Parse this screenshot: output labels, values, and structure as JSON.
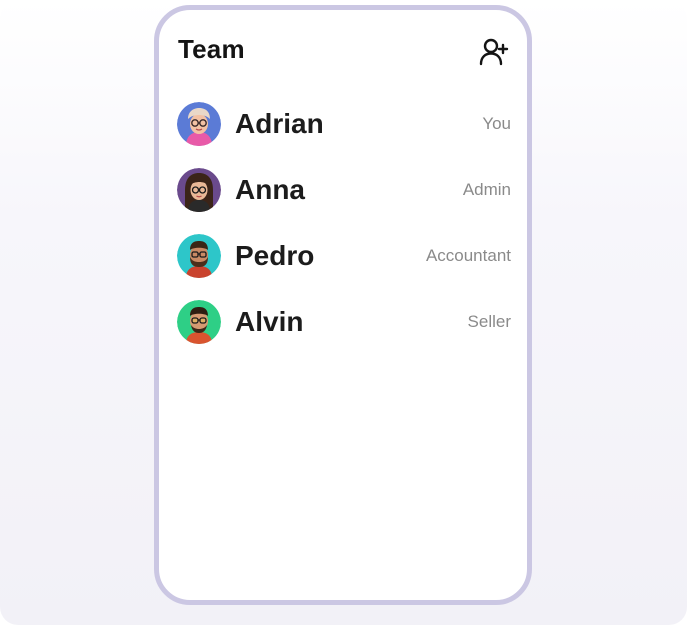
{
  "header": {
    "title": "Team",
    "add_icon": "user-plus-icon"
  },
  "members": [
    {
      "name": "Adrian",
      "role": "You",
      "avatar_bg": "#5b7bd6"
    },
    {
      "name": "Anna",
      "role": "Admin",
      "avatar_bg": "#6a4a8c"
    },
    {
      "name": "Pedro",
      "role": "Accountant",
      "avatar_bg": "#2dc6c9"
    },
    {
      "name": "Alvin",
      "role": "Seller",
      "avatar_bg": "#2ecf86"
    }
  ],
  "colors": {
    "card_border": "#cbc7e3",
    "title_text": "#141414",
    "role_text": "#8a8a8a"
  }
}
